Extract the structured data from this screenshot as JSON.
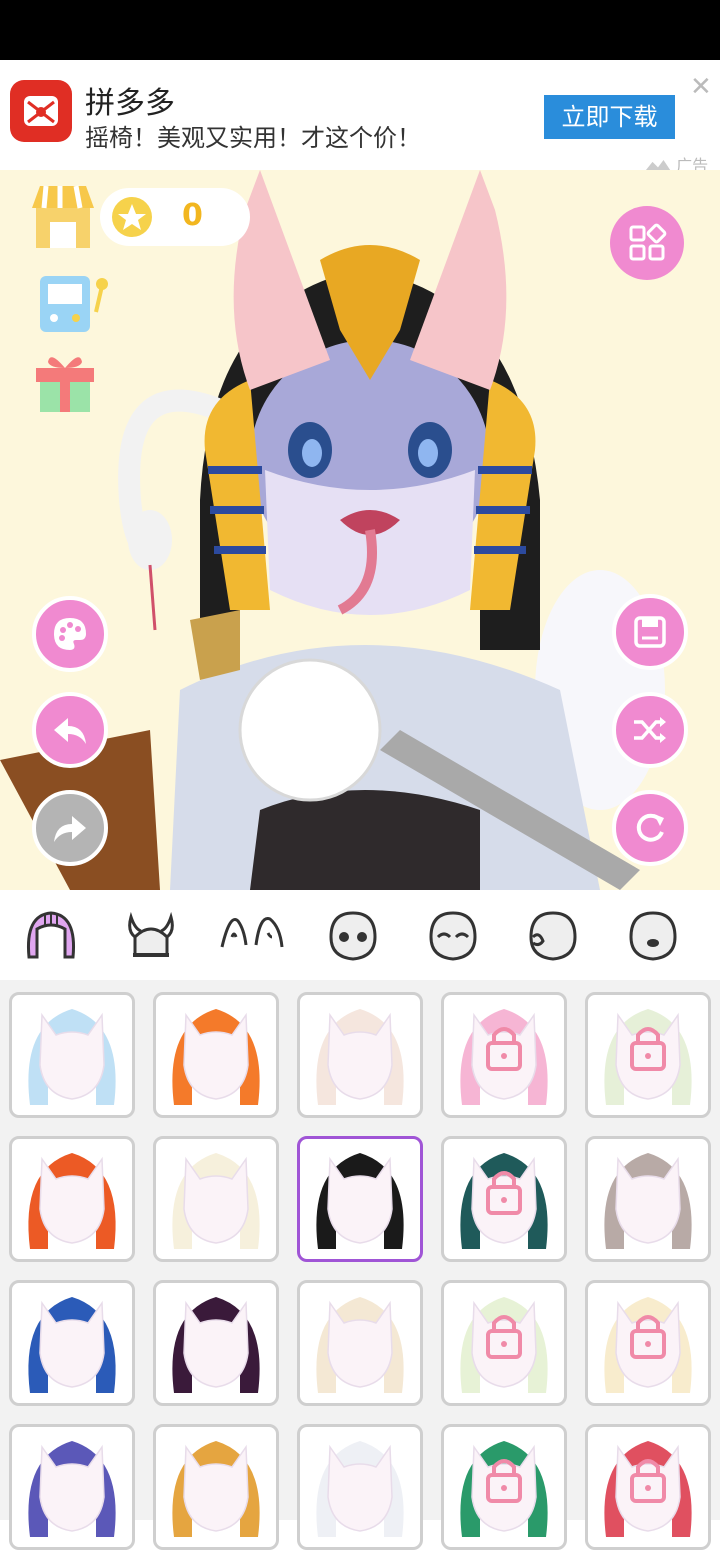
{
  "ad": {
    "app_name": "拼多多",
    "subtitle": "摇椅！美观又实用！才这个价！",
    "cta_label": "立即下载",
    "close_symbol": "✕",
    "ad_tag": "广告",
    "logo_color": "#e02e24",
    "cta_color": "#2a8ddb"
  },
  "stage": {
    "coin_count": "0",
    "background_color": "#fdf7dc",
    "accent_color": "#f08ad0",
    "left_icons": [
      "shop-icon",
      "game-machine-icon",
      "gift-icon"
    ],
    "left_buttons": [
      "palette-icon",
      "undo-icon",
      "redo-icon"
    ],
    "right_buttons": [
      "categories-icon",
      "save-icon",
      "shuffle-icon",
      "reset-icon"
    ]
  },
  "tabs": [
    {
      "name": "hair-tab",
      "selected": true
    },
    {
      "name": "headwear-tab",
      "selected": false
    },
    {
      "name": "ears-tab",
      "selected": false
    },
    {
      "name": "eyes-face-tab",
      "selected": false
    },
    {
      "name": "closed-eyes-face-tab",
      "selected": false
    },
    {
      "name": "side-face-tab",
      "selected": false
    },
    {
      "name": "mouth-face-tab",
      "selected": false
    }
  ],
  "hair_items": [
    {
      "color": "#bfe0f5",
      "locked": false,
      "selected": false
    },
    {
      "color": "#f47a2a",
      "locked": false,
      "selected": false
    },
    {
      "color": "#f5e6de",
      "locked": false,
      "selected": false
    },
    {
      "color": "#f6b5d4",
      "locked": true,
      "selected": false
    },
    {
      "color": "#e6f0d8",
      "locked": true,
      "selected": false
    },
    {
      "color": "#ec5a25",
      "locked": false,
      "selected": false
    },
    {
      "color": "#f6f0dc",
      "locked": false,
      "selected": false
    },
    {
      "color": "#1a1a1a",
      "locked": false,
      "selected": true
    },
    {
      "color": "#1f5a5a",
      "locked": true,
      "selected": false
    },
    {
      "color": "#b8aaa6",
      "locked": false,
      "selected": false
    },
    {
      "color": "#2b5bb8",
      "locked": false,
      "selected": false
    },
    {
      "color": "#3a1a3a",
      "locked": false,
      "selected": false
    },
    {
      "color": "#f4e8d4",
      "locked": false,
      "selected": false
    },
    {
      "color": "#e7f2d6",
      "locked": true,
      "selected": false
    },
    {
      "color": "#f8eccd",
      "locked": true,
      "selected": false
    },
    {
      "color": "#5b58b8",
      "locked": false,
      "selected": false
    },
    {
      "color": "#e5a540",
      "locked": false,
      "selected": false
    },
    {
      "color": "#eef0f5",
      "locked": false,
      "selected": false
    },
    {
      "color": "#2a9a6a",
      "locked": true,
      "selected": false
    },
    {
      "color": "#e05060",
      "locked": true,
      "selected": false
    }
  ]
}
